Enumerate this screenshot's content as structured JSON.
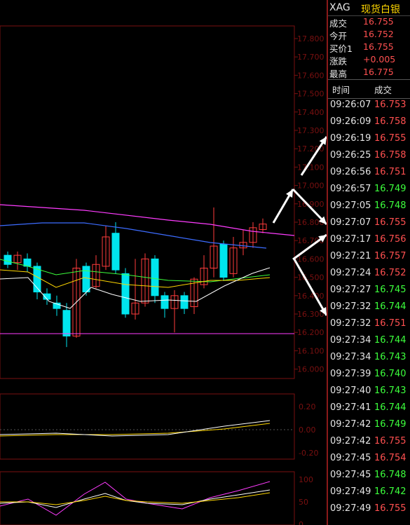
{
  "header": {
    "symbol": "XAG",
    "name": "现货白银"
  },
  "quote": [
    {
      "label": "成交",
      "value": "16.755"
    },
    {
      "label": "今开",
      "value": "16.752"
    },
    {
      "label": "买价1",
      "value": "16.755"
    },
    {
      "label": "涨跌",
      "value": "+0.005"
    },
    {
      "label": "最高",
      "value": "16.775"
    }
  ],
  "ticks_header": {
    "time": "时间",
    "price": "成交"
  },
  "ticks": [
    {
      "time": "09:26:07",
      "price": "16.753",
      "dir": "up"
    },
    {
      "time": "09:26:09",
      "price": "16.758",
      "dir": "up"
    },
    {
      "time": "09:26:19",
      "price": "16.755",
      "dir": "up"
    },
    {
      "time": "09:26:25",
      "price": "16.758",
      "dir": "up"
    },
    {
      "time": "09:26:56",
      "price": "16.751",
      "dir": "up"
    },
    {
      "time": "09:26:57",
      "price": "16.749",
      "dir": "down"
    },
    {
      "time": "09:27:05",
      "price": "16.748",
      "dir": "down"
    },
    {
      "time": "09:27:07",
      "price": "16.755",
      "dir": "up"
    },
    {
      "time": "09:27:17",
      "price": "16.756",
      "dir": "up"
    },
    {
      "time": "09:27:21",
      "price": "16.757",
      "dir": "up"
    },
    {
      "time": "09:27:24",
      "price": "16.752",
      "dir": "up"
    },
    {
      "time": "09:27:27",
      "price": "16.745",
      "dir": "down"
    },
    {
      "time": "09:27:32",
      "price": "16.744",
      "dir": "down"
    },
    {
      "time": "09:27:32",
      "price": "16.751",
      "dir": "up"
    },
    {
      "time": "09:27:34",
      "price": "16.744",
      "dir": "down"
    },
    {
      "time": "09:27:34",
      "price": "16.743",
      "dir": "down"
    },
    {
      "time": "09:27:39",
      "price": "16.740",
      "dir": "down"
    },
    {
      "time": "09:27:40",
      "price": "16.743",
      "dir": "down"
    },
    {
      "time": "09:27:41",
      "price": "16.744",
      "dir": "down"
    },
    {
      "time": "09:27:42",
      "price": "16.749",
      "dir": "down"
    },
    {
      "time": "09:27:42",
      "price": "16.755",
      "dir": "up"
    },
    {
      "time": "09:27:45",
      "price": "16.754",
      "dir": "up"
    },
    {
      "time": "09:27:45",
      "price": "16.748",
      "dir": "down"
    },
    {
      "time": "09:27:49",
      "price": "16.742",
      "dir": "down"
    },
    {
      "time": "09:27:49",
      "price": "16.755",
      "dir": "up"
    }
  ],
  "price_axis": [
    "17.800",
    "17.700",
    "17.600",
    "17.500",
    "17.400",
    "17.300",
    "17.200",
    "17.100",
    "17.000",
    "16.900",
    "16.800",
    "16.700",
    "16.600",
    "16.500",
    "16.400",
    "16.300",
    "16.200",
    "16.100",
    "16.000"
  ],
  "macd_axis": [
    "0.20",
    "0.00",
    "-0.20"
  ],
  "kdj_axis": [
    "100",
    "50",
    "0"
  ],
  "colors": {
    "up": "#ff5050",
    "down": "#3cff3c",
    "bull_candle": "#ff3c3c",
    "bear_candle": "#00e5ee",
    "grid": "#7a1010"
  },
  "candles": [
    {
      "o": 16.62,
      "c": 16.57,
      "h": 16.64,
      "l": 16.55
    },
    {
      "o": 16.58,
      "c": 16.62,
      "h": 16.64,
      "l": 16.54
    },
    {
      "o": 16.6,
      "c": 16.56,
      "h": 16.63,
      "l": 16.53
    },
    {
      "o": 16.56,
      "c": 16.42,
      "h": 16.58,
      "l": 16.38
    },
    {
      "o": 16.41,
      "c": 16.38,
      "h": 16.44,
      "l": 16.35
    },
    {
      "o": 16.36,
      "c": 16.33,
      "h": 16.4,
      "l": 16.29
    },
    {
      "o": 16.32,
      "c": 16.18,
      "h": 16.36,
      "l": 16.12
    },
    {
      "o": 16.18,
      "c": 16.55,
      "h": 16.6,
      "l": 16.17
    },
    {
      "o": 16.56,
      "c": 16.42,
      "h": 16.58,
      "l": 16.4
    },
    {
      "o": 16.45,
      "c": 16.57,
      "h": 16.62,
      "l": 16.44
    },
    {
      "o": 16.56,
      "c": 16.72,
      "h": 16.78,
      "l": 16.54
    },
    {
      "o": 16.74,
      "c": 16.54,
      "h": 16.8,
      "l": 16.52
    },
    {
      "o": 16.52,
      "c": 16.3,
      "h": 16.55,
      "l": 16.28
    },
    {
      "o": 16.3,
      "c": 16.36,
      "h": 16.6,
      "l": 16.27
    },
    {
      "o": 16.36,
      "c": 16.6,
      "h": 16.63,
      "l": 16.34
    },
    {
      "o": 16.6,
      "c": 16.4,
      "h": 16.62,
      "l": 16.36
    },
    {
      "o": 16.4,
      "c": 16.33,
      "h": 16.42,
      "l": 16.28
    },
    {
      "o": 16.33,
      "c": 16.4,
      "h": 16.43,
      "l": 16.2
    },
    {
      "o": 16.4,
      "c": 16.33,
      "h": 16.42,
      "l": 16.3
    },
    {
      "o": 16.34,
      "c": 16.49,
      "h": 16.5,
      "l": 16.3
    },
    {
      "o": 16.46,
      "c": 16.55,
      "h": 16.62,
      "l": 16.44
    },
    {
      "o": 16.55,
      "c": 16.67,
      "h": 16.88,
      "l": 16.5
    },
    {
      "o": 16.68,
      "c": 16.5,
      "h": 16.7,
      "l": 16.48
    },
    {
      "o": 16.52,
      "c": 16.66,
      "h": 16.72,
      "l": 16.5
    },
    {
      "o": 16.66,
      "c": 16.69,
      "h": 16.76,
      "l": 16.62
    },
    {
      "o": 16.69,
      "c": 16.77,
      "h": 16.8,
      "l": 16.66
    },
    {
      "o": 16.76,
      "c": 16.79,
      "h": 16.82,
      "l": 16.74
    }
  ]
}
